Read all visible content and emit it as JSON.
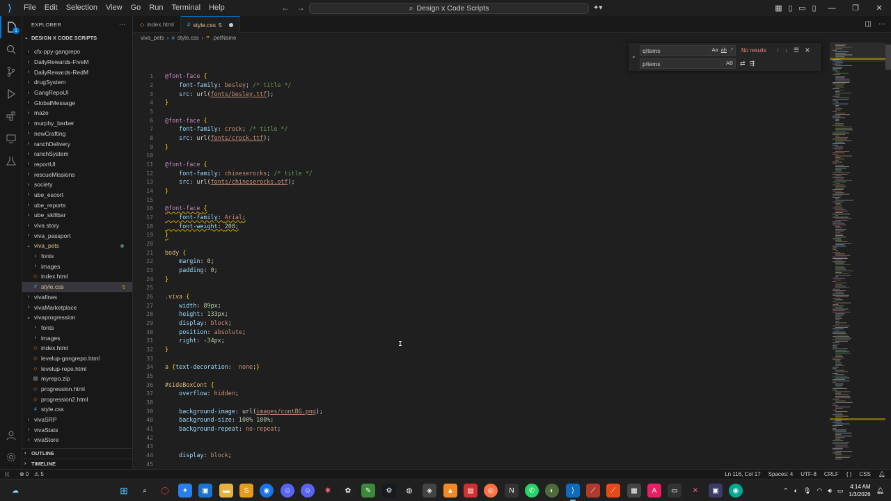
{
  "menu": [
    "File",
    "Edit",
    "Selection",
    "View",
    "Go",
    "Run",
    "Terminal",
    "Help"
  ],
  "command_center": "Design x Code Scripts",
  "explorer": {
    "title": "EXPLORER",
    "folder": "DESIGN X CODE SCRIPTS",
    "items": [
      {
        "label": "cfx-ppy-gangrepo",
        "depth": 1,
        "kind": "folder"
      },
      {
        "label": "DailyRewards-FiveM",
        "depth": 1,
        "kind": "folder"
      },
      {
        "label": "DailyRewards-RedM",
        "depth": 1,
        "kind": "folder"
      },
      {
        "label": "drugSystem",
        "depth": 1,
        "kind": "folder"
      },
      {
        "label": "GangRepoUI",
        "depth": 1,
        "kind": "folder"
      },
      {
        "label": "GlobalMessage",
        "depth": 1,
        "kind": "folder"
      },
      {
        "label": "maze",
        "depth": 1,
        "kind": "folder"
      },
      {
        "label": "murphy_barber",
        "depth": 1,
        "kind": "folder"
      },
      {
        "label": "newCrafting",
        "depth": 1,
        "kind": "folder"
      },
      {
        "label": "ranchDelivery",
        "depth": 1,
        "kind": "folder"
      },
      {
        "label": "ranchSystem",
        "depth": 1,
        "kind": "folder"
      },
      {
        "label": "reportUI",
        "depth": 1,
        "kind": "folder"
      },
      {
        "label": "rescueMissions",
        "depth": 1,
        "kind": "folder"
      },
      {
        "label": "society",
        "depth": 1,
        "kind": "folder"
      },
      {
        "label": "ube_escort",
        "depth": 1,
        "kind": "folder"
      },
      {
        "label": "ube_reports",
        "depth": 1,
        "kind": "folder"
      },
      {
        "label": "ube_skillbar",
        "depth": 1,
        "kind": "folder"
      },
      {
        "label": "viva story",
        "depth": 1,
        "kind": "folder"
      },
      {
        "label": "viva_passport",
        "depth": 1,
        "kind": "folder"
      },
      {
        "label": "viva_pets",
        "depth": 1,
        "kind": "folder-open",
        "modified": true
      },
      {
        "label": "fonts",
        "depth": 2,
        "kind": "folder"
      },
      {
        "label": "images",
        "depth": 2,
        "kind": "folder"
      },
      {
        "label": "index.html",
        "depth": 2,
        "kind": "html"
      },
      {
        "label": "style.css",
        "depth": 2,
        "kind": "css",
        "selected": true,
        "count": "5"
      },
      {
        "label": "vivafines",
        "depth": 1,
        "kind": "folder"
      },
      {
        "label": "vivaMarketplace",
        "depth": 1,
        "kind": "folder"
      },
      {
        "label": "vivaprogression",
        "depth": 1,
        "kind": "folder-open"
      },
      {
        "label": "fonts",
        "depth": 2,
        "kind": "folder"
      },
      {
        "label": "images",
        "depth": 2,
        "kind": "folder"
      },
      {
        "label": "index.html",
        "depth": 2,
        "kind": "html"
      },
      {
        "label": "levelup-gangrepo.html",
        "depth": 2,
        "kind": "html"
      },
      {
        "label": "levelup-repo.html",
        "depth": 2,
        "kind": "html"
      },
      {
        "label": "myrepo.zip",
        "depth": 2,
        "kind": "zip"
      },
      {
        "label": "progression.html",
        "depth": 2,
        "kind": "html"
      },
      {
        "label": "progression2.html",
        "depth": 2,
        "kind": "html"
      },
      {
        "label": "style.css",
        "depth": 2,
        "kind": "css"
      },
      {
        "label": "vivaSRP",
        "depth": 1,
        "kind": "folder"
      },
      {
        "label": "vivaStats",
        "depth": 1,
        "kind": "folder"
      },
      {
        "label": "vivaStore",
        "depth": 1,
        "kind": "folder"
      }
    ],
    "outline": "OUTLINE",
    "timeline": "TIMELINE"
  },
  "tabs": [
    {
      "label": "index.html",
      "icon": "html"
    },
    {
      "label": "style.css",
      "count": "5",
      "active": true
    }
  ],
  "breadcrumb": [
    "viva_pets",
    "style.css",
    ".petName"
  ],
  "find": {
    "find_value": "qItems",
    "replace_value": "pItems",
    "result": "No results",
    "opt_case": "Aa",
    "opt_word": "ab",
    "opt_regex": ".*",
    "opt_preserve": "AB"
  },
  "status": {
    "errors": "0",
    "warnings": "5",
    "position": "Ln 116, Col 17",
    "spaces": "Spaces: 4",
    "encoding": "UTF-8",
    "eol": "CRLF",
    "language": "CSS"
  },
  "clock": {
    "time": "4:14 AM",
    "date": "1/3/2026"
  },
  "code": [
    {
      "n": "1",
      "t": [
        [
          "k",
          "@font-face"
        ],
        [
          "w",
          " "
        ],
        [
          "br",
          "{"
        ]
      ]
    },
    {
      "n": "2",
      "t": [
        [
          "w",
          "    "
        ],
        [
          "p",
          "font-family"
        ],
        [
          "w",
          ": "
        ],
        [
          "v",
          "besley"
        ],
        [
          "w",
          "; "
        ],
        [
          "c",
          "/* title */"
        ]
      ]
    },
    {
      "n": "3",
      "t": [
        [
          "w",
          "    "
        ],
        [
          "p",
          "src"
        ],
        [
          "w",
          ": "
        ],
        [
          "w",
          "url("
        ],
        [
          "u",
          "fonts/besley.ttf"
        ],
        [
          "w",
          ");"
        ]
      ]
    },
    {
      "n": "4",
      "t": [
        [
          "br",
          "}"
        ]
      ]
    },
    {
      "n": "5",
      "t": []
    },
    {
      "n": "6",
      "t": [
        [
          "k",
          "@font-face"
        ],
        [
          "w",
          " "
        ],
        [
          "br",
          "{"
        ]
      ]
    },
    {
      "n": "7",
      "t": [
        [
          "w",
          "    "
        ],
        [
          "p",
          "font-family"
        ],
        [
          "w",
          ": "
        ],
        [
          "v",
          "crock"
        ],
        [
          "w",
          "; "
        ],
        [
          "c",
          "/* title */"
        ]
      ]
    },
    {
      "n": "8",
      "t": [
        [
          "w",
          "    "
        ],
        [
          "p",
          "src"
        ],
        [
          "w",
          ": "
        ],
        [
          "w",
          "url("
        ],
        [
          "u",
          "fonts/crock.ttf"
        ],
        [
          "w",
          ");"
        ]
      ]
    },
    {
      "n": "9",
      "t": [
        [
          "br",
          "}"
        ]
      ]
    },
    {
      "n": "10",
      "t": []
    },
    {
      "n": "11",
      "t": [
        [
          "k",
          "@font-face"
        ],
        [
          "w",
          " "
        ],
        [
          "br",
          "{"
        ]
      ]
    },
    {
      "n": "12",
      "t": [
        [
          "w",
          "    "
        ],
        [
          "p",
          "font-family"
        ],
        [
          "w",
          ": "
        ],
        [
          "v",
          "chineserocks"
        ],
        [
          "w",
          "; "
        ],
        [
          "c",
          "/* title */"
        ]
      ]
    },
    {
      "n": "13",
      "t": [
        [
          "w",
          "    "
        ],
        [
          "p",
          "src"
        ],
        [
          "w",
          ": "
        ],
        [
          "w",
          "url("
        ],
        [
          "u",
          "fonts/chineserocks.otf"
        ],
        [
          "w",
          ");"
        ]
      ]
    },
    {
      "n": "14",
      "t": [
        [
          "br",
          "}"
        ]
      ]
    },
    {
      "n": "15",
      "t": []
    },
    {
      "n": "16",
      "t": [
        [
          "k",
          "@font-face"
        ],
        [
          "w",
          " "
        ],
        [
          "br",
          "{"
        ]
      ],
      "warn": true
    },
    {
      "n": "17",
      "t": [
        [
          "w",
          "    "
        ],
        [
          "p",
          "font-family"
        ],
        [
          "w",
          ": "
        ],
        [
          "v",
          "Arial"
        ],
        [
          "w",
          ";"
        ]
      ],
      "warn": true
    },
    {
      "n": "18",
      "t": [
        [
          "w",
          "    "
        ],
        [
          "p",
          "font-weight"
        ],
        [
          "w",
          ": "
        ],
        [
          "n",
          "200"
        ],
        [
          "w",
          ";"
        ]
      ],
      "warn": true
    },
    {
      "n": "19",
      "t": [
        [
          "br",
          "}"
        ]
      ],
      "warn": true
    },
    {
      "n": "20",
      "t": []
    },
    {
      "n": "21",
      "t": [
        [
          "sel-c",
          "body"
        ],
        [
          "w",
          " "
        ],
        [
          "br",
          "{"
        ]
      ]
    },
    {
      "n": "22",
      "t": [
        [
          "w",
          "    "
        ],
        [
          "p",
          "margin"
        ],
        [
          "w",
          ": "
        ],
        [
          "n",
          "0"
        ],
        [
          "w",
          ";"
        ]
      ]
    },
    {
      "n": "23",
      "t": [
        [
          "w",
          "    "
        ],
        [
          "p",
          "padding"
        ],
        [
          "w",
          ": "
        ],
        [
          "n",
          "0"
        ],
        [
          "w",
          ";"
        ]
      ]
    },
    {
      "n": "24",
      "t": [
        [
          "br",
          "}"
        ]
      ]
    },
    {
      "n": "25",
      "t": []
    },
    {
      "n": "26",
      "t": [
        [
          "sel-c",
          ".viva"
        ],
        [
          "w",
          " "
        ],
        [
          "br",
          "{"
        ]
      ]
    },
    {
      "n": "27",
      "t": [
        [
          "w",
          "    "
        ],
        [
          "p",
          "width"
        ],
        [
          "w",
          ": "
        ],
        [
          "n",
          "89px"
        ],
        [
          "w",
          ";"
        ]
      ]
    },
    {
      "n": "28",
      "t": [
        [
          "w",
          "    "
        ],
        [
          "p",
          "height"
        ],
        [
          "w",
          ": "
        ],
        [
          "n",
          "133px"
        ],
        [
          "w",
          ";"
        ]
      ]
    },
    {
      "n": "29",
      "t": [
        [
          "w",
          "    "
        ],
        [
          "p",
          "display"
        ],
        [
          "w",
          ": "
        ],
        [
          "v",
          "block"
        ],
        [
          "w",
          ";"
        ]
      ]
    },
    {
      "n": "30",
      "t": [
        [
          "w",
          "    "
        ],
        [
          "p",
          "position"
        ],
        [
          "w",
          ": "
        ],
        [
          "v",
          "absolute"
        ],
        [
          "w",
          ";"
        ]
      ]
    },
    {
      "n": "31",
      "t": [
        [
          "w",
          "    "
        ],
        [
          "p",
          "right"
        ],
        [
          "w",
          ": "
        ],
        [
          "n",
          "-34px"
        ],
        [
          "w",
          ";"
        ]
      ]
    },
    {
      "n": "32",
      "t": [
        [
          "br",
          "}"
        ]
      ]
    },
    {
      "n": "33",
      "t": []
    },
    {
      "n": "34",
      "t": [
        [
          "sel-c",
          "a"
        ],
        [
          "w",
          " "
        ],
        [
          "br",
          "{"
        ],
        [
          "p",
          "text-decoration"
        ],
        [
          "w",
          ":  "
        ],
        [
          "v",
          "none"
        ],
        [
          "w",
          ";"
        ],
        [
          "br",
          "}"
        ]
      ]
    },
    {
      "n": "35",
      "t": []
    },
    {
      "n": "36",
      "t": [
        [
          "sel-c",
          "#sideBoxCont"
        ],
        [
          "w",
          " "
        ],
        [
          "br",
          "{"
        ]
      ]
    },
    {
      "n": "37",
      "t": [
        [
          "w",
          "    "
        ],
        [
          "p",
          "overflow"
        ],
        [
          "w",
          ": "
        ],
        [
          "v",
          "hidden"
        ],
        [
          "w",
          ";"
        ]
      ]
    },
    {
      "n": "38",
      "t": []
    },
    {
      "n": "39",
      "t": [
        [
          "w",
          "    "
        ],
        [
          "p",
          "background-image"
        ],
        [
          "w",
          ": "
        ],
        [
          "w",
          "url("
        ],
        [
          "u",
          "images/contBG.png"
        ],
        [
          "w",
          ");"
        ]
      ]
    },
    {
      "n": "40",
      "t": [
        [
          "w",
          "    "
        ],
        [
          "p",
          "background-size"
        ],
        [
          "w",
          ": "
        ],
        [
          "n",
          "100% 100%"
        ],
        [
          "w",
          ";"
        ]
      ]
    },
    {
      "n": "41",
      "t": [
        [
          "w",
          "    "
        ],
        [
          "p",
          "background-repeat"
        ],
        [
          "w",
          ": "
        ],
        [
          "v",
          "no-repeat"
        ],
        [
          "w",
          ";"
        ]
      ]
    },
    {
      "n": "42",
      "t": []
    },
    {
      "n": "43",
      "t": []
    },
    {
      "n": "44",
      "t": [
        [
          "w",
          "    "
        ],
        [
          "p",
          "display"
        ],
        [
          "w",
          ": "
        ],
        [
          "v",
          "block"
        ],
        [
          "w",
          ";"
        ]
      ]
    },
    {
      "n": "45",
      "t": []
    }
  ],
  "colors": {
    "accent": "#0078d4",
    "keyword": "#c586c0",
    "selector": "#d7ba7d",
    "property": "#9cdcfe",
    "value": "#ce9178",
    "number": "#b5cea8",
    "comment": "#6a9955",
    "warning": "#cca700"
  }
}
